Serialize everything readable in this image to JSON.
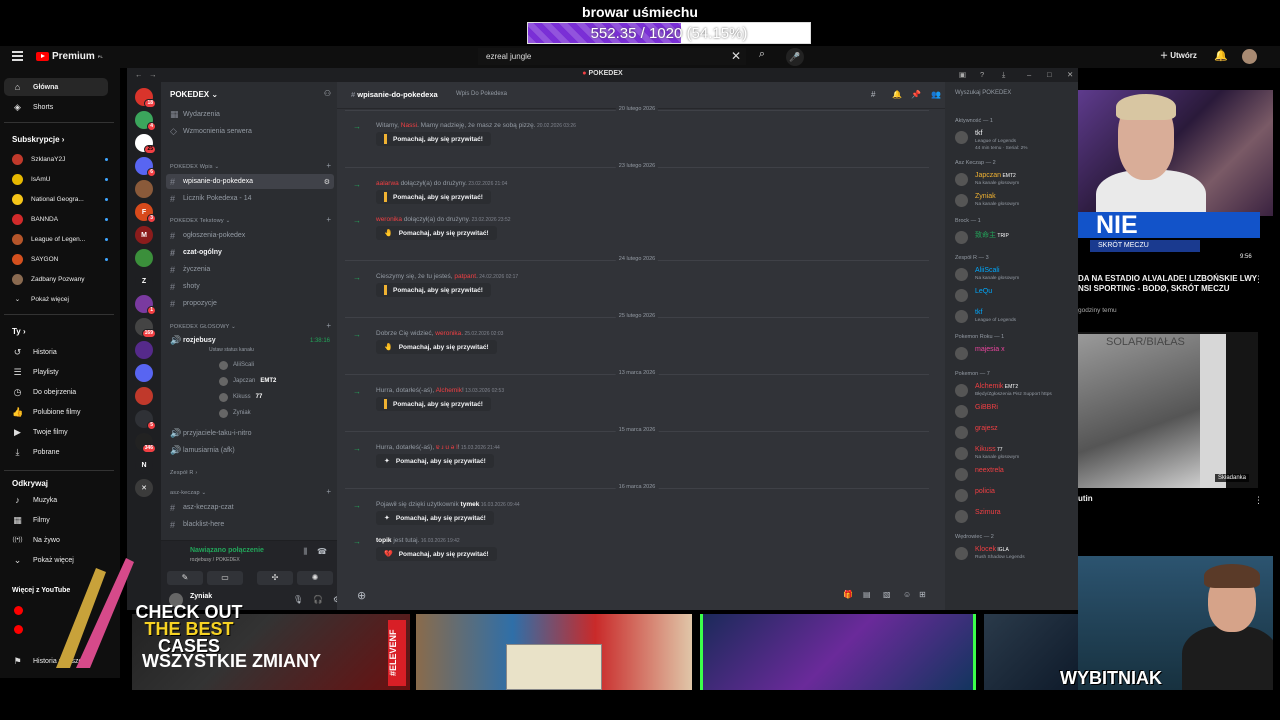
{
  "overlay": {
    "title": "browar uśmiechu",
    "goal_text": "552.35 / 1020 (54.15%)",
    "goal_fraction": 0.5415,
    "goal_color": "#7a2fd6"
  },
  "youtube": {
    "logo": "Premium",
    "logo_sup": "PL",
    "search_value": "ezreal jungle",
    "create_label": "Utwórz",
    "sidebar": {
      "main": [
        {
          "label": "Główna",
          "icon": "home-icon"
        },
        {
          "label": "Shorts",
          "icon": "shorts-icon"
        }
      ],
      "subs_header": "Subskrypcje",
      "subscriptions": [
        {
          "label": "SzklanaY2J",
          "color": "#c0392b"
        },
        {
          "label": "IsAmU",
          "color": "#e6b800"
        },
        {
          "label": "National Geogra...",
          "color": "#f5c518"
        },
        {
          "label": "BANNDA",
          "color": "#d12a2a"
        },
        {
          "label": "League of Legen...",
          "color": "#b5552a"
        },
        {
          "label": "SAYGON",
          "color": "#d4501e"
        },
        {
          "label": "Zadbany Pozwany",
          "color": "#8a6a50"
        }
      ],
      "show_more": "Pokaż więcej",
      "you_header": "Ty",
      "you_items": [
        {
          "label": "Historia",
          "icon": "history-icon"
        },
        {
          "label": "Playlisty",
          "icon": "playlist-icon"
        },
        {
          "label": "Do obejrzenia",
          "icon": "clock-icon"
        },
        {
          "label": "Polubione filmy",
          "icon": "thumb-up-icon"
        },
        {
          "label": "Twoje filmy",
          "icon": "video-icon"
        },
        {
          "label": "Pobrane",
          "icon": "download-icon"
        }
      ],
      "explore_header": "Odkrywaj",
      "explore_items": [
        {
          "label": "Muzyka",
          "icon": "music-icon"
        },
        {
          "label": "Filmy",
          "icon": "film-icon"
        },
        {
          "label": "Na żywo",
          "icon": "live-icon"
        },
        {
          "label": "Pokaż więcej",
          "icon": "chevron-down-icon"
        }
      ],
      "more_header": "Więcej z YouTube",
      "history_report": "Historia zgłoszeń"
    },
    "right": {
      "banner": "NIE ODPODO!",
      "banner_sub": "SKRÓT MECZU",
      "video1_title": "DA NA ESTADIO ALVALADE! LIZBOŃSKIE LWY NSI SPORTING - BODØ, SKRÓT MECZU",
      "video1_meta": "godziny temu",
      "video1_duration": "9:56",
      "thumb2_text": "SOLAR/BIAŁAS",
      "thumb2_tag": "Składanka",
      "video2_title": "utin"
    }
  },
  "discord": {
    "window_title": "POKEDEX",
    "server_name": "POKEDEX",
    "servers": [
      {
        "label": "",
        "color": "#d9342b",
        "badge": "18"
      },
      {
        "label": "",
        "color": "#3ba55c",
        "badge": "4"
      },
      {
        "label": "",
        "color": "#ffffff",
        "badge": "25"
      },
      {
        "label": "",
        "color": "#5865f2",
        "badge": "6"
      },
      {
        "label": "",
        "color": "#8a5a3a",
        "badge": ""
      },
      {
        "label": "F",
        "color": "#d84a1b",
        "badge": "3"
      },
      {
        "label": "M",
        "color": "#8b1c1c",
        "badge": ""
      },
      {
        "label": "",
        "color": "#3b8f3b",
        "badge": ""
      },
      {
        "label": "Z",
        "color": "#1e1f22",
        "badge": ""
      },
      {
        "label": "",
        "color": "#7a3aa0",
        "badge": "1"
      },
      {
        "label": "",
        "color": "#444444",
        "badge": "169"
      },
      {
        "label": "",
        "color": "#552a8a",
        "badge": ""
      },
      {
        "label": "",
        "color": "#5865f2",
        "badge": ""
      },
      {
        "label": "",
        "color": "#c0392b",
        "badge": ""
      },
      {
        "label": "",
        "color": "#2f3136",
        "badge": "5"
      },
      {
        "label": "",
        "color": "#222222",
        "badge": "346"
      },
      {
        "label": "N",
        "color": "#1e1f22",
        "badge": ""
      },
      {
        "label": "✕",
        "color": "#3b3b3b",
        "badge": ""
      }
    ],
    "top_links": [
      "Wydarzenia",
      "Wzmocnienia serwera"
    ],
    "categories": {
      "wpis": "POKEDEX Wpis",
      "tekstowy": "POKEDEX Tekstowy",
      "glosowy": "POKEDEX GŁOSOWY",
      "zespol": "Zespół R",
      "asz": "asz-keczap"
    },
    "channels_wpis": [
      {
        "label": "wpisanie-do-pokedexa",
        "active": true
      },
      {
        "label": "Licznik Pokedexa - 14",
        "active": false
      }
    ],
    "channels_text": [
      {
        "label": "ogłoszenia-pokedex",
        "bold": false
      },
      {
        "label": "czat-ogólny",
        "bold": true
      },
      {
        "label": "życzenia",
        "bold": false
      },
      {
        "label": "shoty",
        "bold": false
      },
      {
        "label": "propozycje",
        "bold": false
      }
    ],
    "voice_channel": "rozjebusy",
    "voice_status": "Ustaw status kanału",
    "voice_timer": "1:38:16",
    "voice_users": [
      {
        "name": "AliiScali",
        "tag": ""
      },
      {
        "name": "Japczan",
        "tag": "EMT2"
      },
      {
        "name": "Kikuss",
        "tag": "77"
      },
      {
        "name": "Zyniak",
        "tag": ""
      }
    ],
    "channels_voice_more": [
      "przyjaciele-taku-i-nitro",
      "lamusiarnia (afk)"
    ],
    "channels_asz": [
      "asz-keczap-czat",
      "blacklist-here"
    ],
    "voice_panel": {
      "status": "Nawiązano połączenie",
      "sub": "rozjebusy / POKEDEX",
      "user": "Zyniak",
      "user_status": "Na kanale"
    },
    "chat": {
      "channel": "wpisanie-do-pokedexa",
      "topic": "Wpis Do Pokedexa",
      "wave_label": "Pomachaj, aby się przywitać!",
      "dates": [
        "20 lutego 2026",
        "23 lutego 2026",
        "24 lutego 2026",
        "25 lutego 2026",
        "13 marca 2026",
        "15 marca 2026",
        "16 marca 2026"
      ],
      "messages": [
        {
          "pre": "Witamy, ",
          "who": "Nassi",
          "post": ". Mamy nadzieję, że masz ze sobą pizzę.",
          "ts": "20.02.2026 03:26"
        },
        {
          "pre": "",
          "who": "aalarwa",
          "post": " dołączył(a) do drużyny.",
          "ts": "23.02.2026 21:04"
        },
        {
          "pre": "",
          "who": "weronika",
          "post": " dołączył(a) do drużyny.",
          "ts": "23.02.2026 23:52"
        },
        {
          "pre": "Cieszymy się, że tu jesteś, ",
          "who": "patpant",
          "post": ".",
          "ts": "24.02.2026 02:17"
        },
        {
          "pre": "Dobrze Cię widzieć, ",
          "who": "weronika",
          "post": ".",
          "ts": "25.02.2026 02:03"
        },
        {
          "pre": "Hurra, dotarłeś(-aś), ",
          "who": "Alchemik",
          "post": "!",
          "ts": "13.03.2026 02:53"
        },
        {
          "pre": "Hurra, dotarłeś(-aś), ",
          "who": "ɐ ɹ u ǝ l",
          "post": "!",
          "ts": "15.03.2026 21:44"
        },
        {
          "pre": "Pojawił się dzięki użytkownik ",
          "who": "tymek",
          "post": "",
          "ts": "16.03.2026 09:44"
        },
        {
          "pre": "",
          "who": "topik",
          "post": " jest tutaj.",
          "ts": "16.03.2026 19:42"
        }
      ]
    },
    "members": {
      "search": "Wyszukaj POKEDEX",
      "groups": [
        {
          "header": "Aktywność — 1",
          "items": [
            {
              "name": "tkf",
              "status": "League of Legends",
              "sub": "44 min temu · Serial: 2%",
              "color": "#f2f3f5"
            }
          ]
        },
        {
          "header": "Asz Keczap — 2",
          "items": [
            {
              "name": "Japczan",
              "status": "Na kanale głosowym",
              "tag": "EMT2",
              "color": "#f0b232"
            },
            {
              "name": "Zyniak",
              "status": "Na kanale głosowym",
              "tag": "",
              "color": "#f0b232"
            }
          ]
        },
        {
          "header": "Brock — 1",
          "items": [
            {
              "name": "致命主",
              "status": "",
              "tag": "TRIP",
              "color": "#23a55a"
            }
          ]
        },
        {
          "header": "Zespół R — 3",
          "items": [
            {
              "name": "AliiScali",
              "status": "Na kanale głosowym",
              "tag": "",
              "color": "#00a8fc"
            },
            {
              "name": "LeQu",
              "status": "",
              "tag": "",
              "color": "#00a8fc"
            },
            {
              "name": "tkf",
              "status": "League of Legends",
              "tag": "",
              "color": "#00a8fc"
            }
          ]
        },
        {
          "header": "Pokemon Roku — 1",
          "items": [
            {
              "name": "majesia x",
              "status": "",
              "tag": "",
              "color": "#eb459e"
            }
          ]
        },
        {
          "header": "Pokemon — 7",
          "items": [
            {
              "name": "Alchemik",
              "status": "Błędy/Zgłoszenia Pisz Support https",
              "tag": "EMT2",
              "color": "#f23f43"
            },
            {
              "name": "GiBBRi",
              "status": "",
              "tag": "",
              "color": "#f23f43"
            },
            {
              "name": "grajesz",
              "status": "",
              "tag": "",
              "color": "#f23f43"
            },
            {
              "name": "Kikuss",
              "status": "Na kanale głosowym",
              "tag": "77",
              "color": "#f23f43"
            },
            {
              "name": "neextrela",
              "status": "",
              "tag": "",
              "color": "#f23f43"
            },
            {
              "name": "policia",
              "status": "",
              "tag": "",
              "color": "#f23f43"
            },
            {
              "name": "Szimura",
              "status": "",
              "tag": "",
              "color": "#f23f43"
            }
          ]
        },
        {
          "header": "Wędrowiec — 2",
          "items": [
            {
              "name": "Klocek",
              "status": "Rush Shadow Legends",
              "tag": "IGLA",
              "color": "#f23f43"
            }
          ]
        }
      ]
    }
  },
  "bottom": {
    "ad_line1": "CHECK OUT",
    "ad_line2": "THE BEST",
    "ad_line3": "CASES",
    "thumb1_text": "WSZYSTKIE ZMIANY",
    "thumb1_tag": "#ELEVENF",
    "thumb4_text": "WYBITNIAK"
  }
}
